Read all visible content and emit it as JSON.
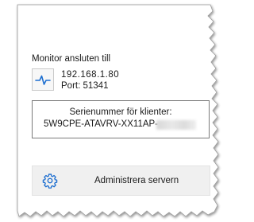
{
  "monitor": {
    "title": "Monitor ansluten till",
    "ip": "192.168.1.80",
    "port": "Port: 51341",
    "icon": "activity-icon"
  },
  "serial": {
    "label": "Serienummer för klienter:",
    "value": "5W9CPE-ATAVRV-XX11AP-"
  },
  "actions": {
    "admin_label": "Administrera servern",
    "admin_icon": "gear-icon"
  },
  "colors": {
    "accent": "#1e6fd0",
    "button_bg": "#f0f0f0",
    "border": "#7a7a7a"
  }
}
